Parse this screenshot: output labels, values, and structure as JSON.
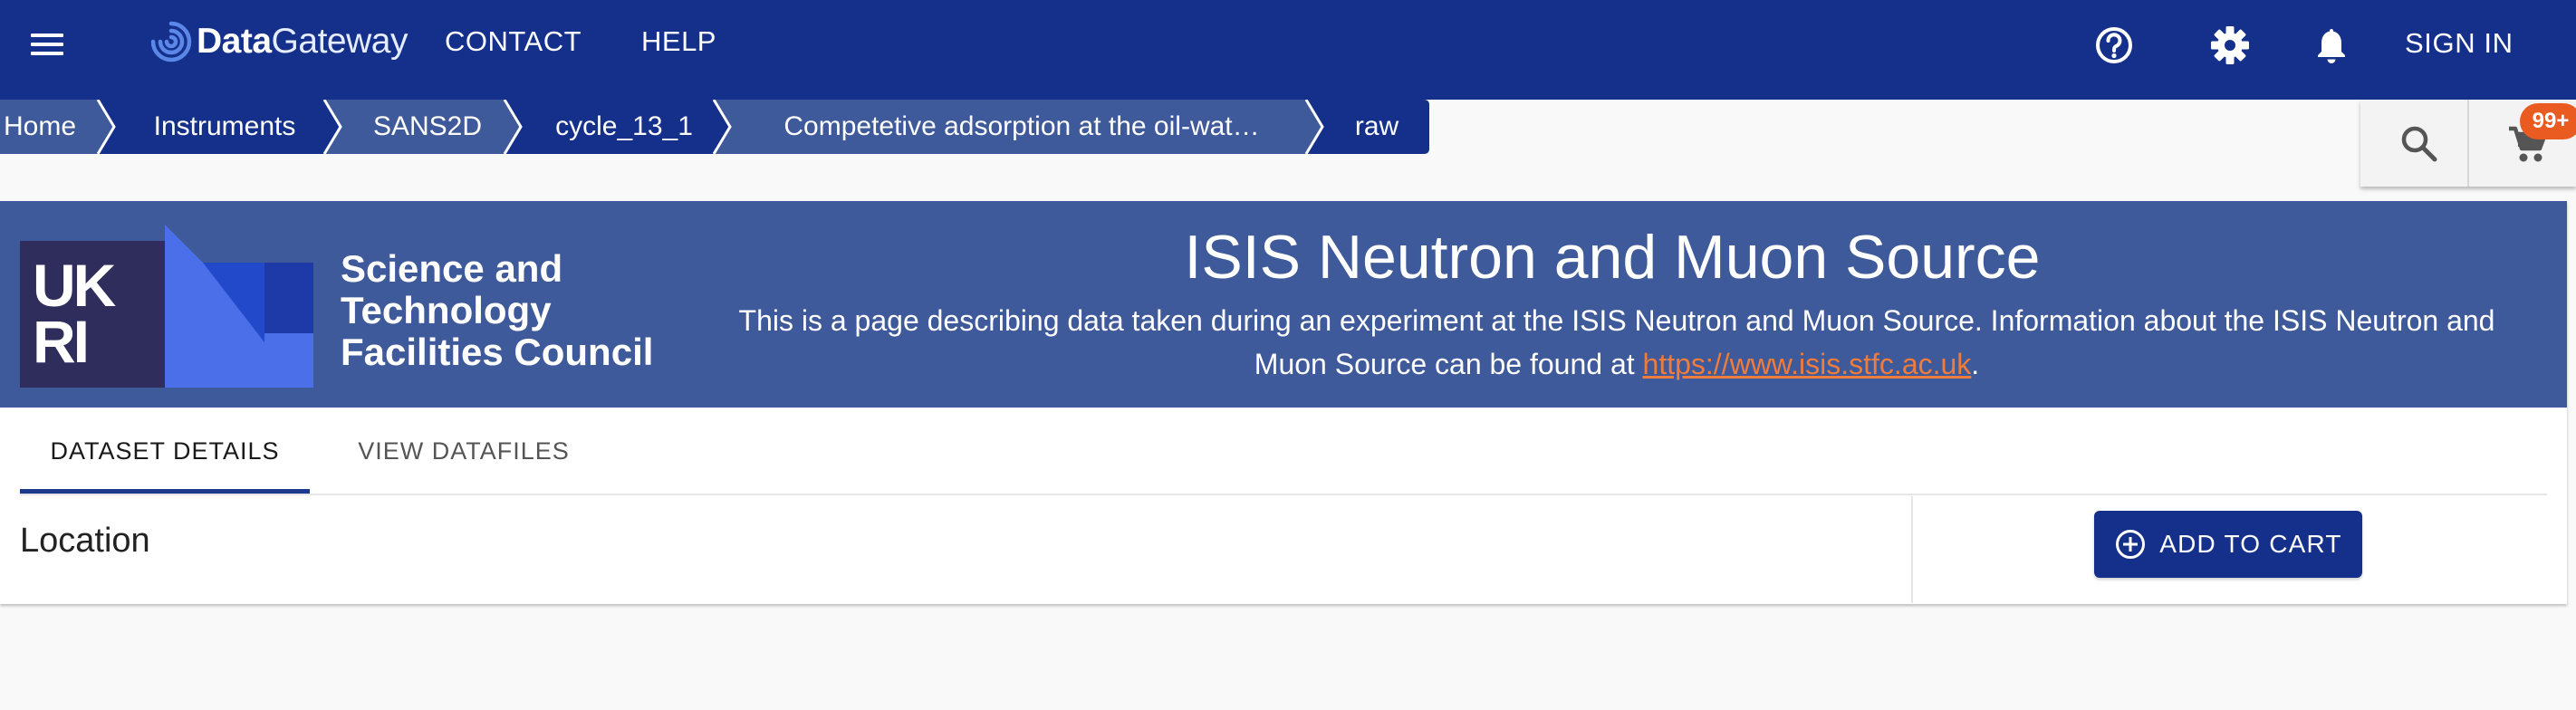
{
  "app": {
    "logo_bold": "Data",
    "logo_light": "Gateway",
    "nav": [
      "CONTACT",
      "HELP"
    ],
    "sign_in": "SIGN IN",
    "icons": {
      "menu": "menu-icon",
      "help": "help-circle-icon",
      "settings": "gear-icon",
      "notifications": "bell-icon",
      "search": "search-icon",
      "cart": "cart-icon"
    },
    "cart_count": "99+"
  },
  "breadcrumb": [
    "Home",
    "Instruments",
    "SANS2D",
    "cycle_13_1",
    "Competetive adsorption at the oil-wat…",
    "raw"
  ],
  "banner": {
    "logo_text": "UK RI",
    "org_name": [
      "Science and",
      "Technology",
      "Facilities Council"
    ],
    "title": "ISIS Neutron and Muon Source",
    "description": "This is a page describing data taken during an experiment at the ISIS Neutron and Muon Source. Information about the ISIS Neutron and Muon Source can be found at ",
    "link": "https://www.isis.stfc.ac.uk",
    "description_end": "."
  },
  "tabs": [
    {
      "label": "DATASET DETAILS",
      "active": true
    },
    {
      "label": "VIEW DATAFILES",
      "active": false
    }
  ],
  "details": {
    "section_title": "Location",
    "add_to_cart": "ADD TO CART"
  },
  "colors": {
    "appbar": "#14308a",
    "breadcrumb_light": "#3f5a9a",
    "breadcrumb_dark": "#14308a",
    "banner": "#3f5a9a",
    "link": "#f07c3b",
    "badge": "#ea5b22"
  }
}
